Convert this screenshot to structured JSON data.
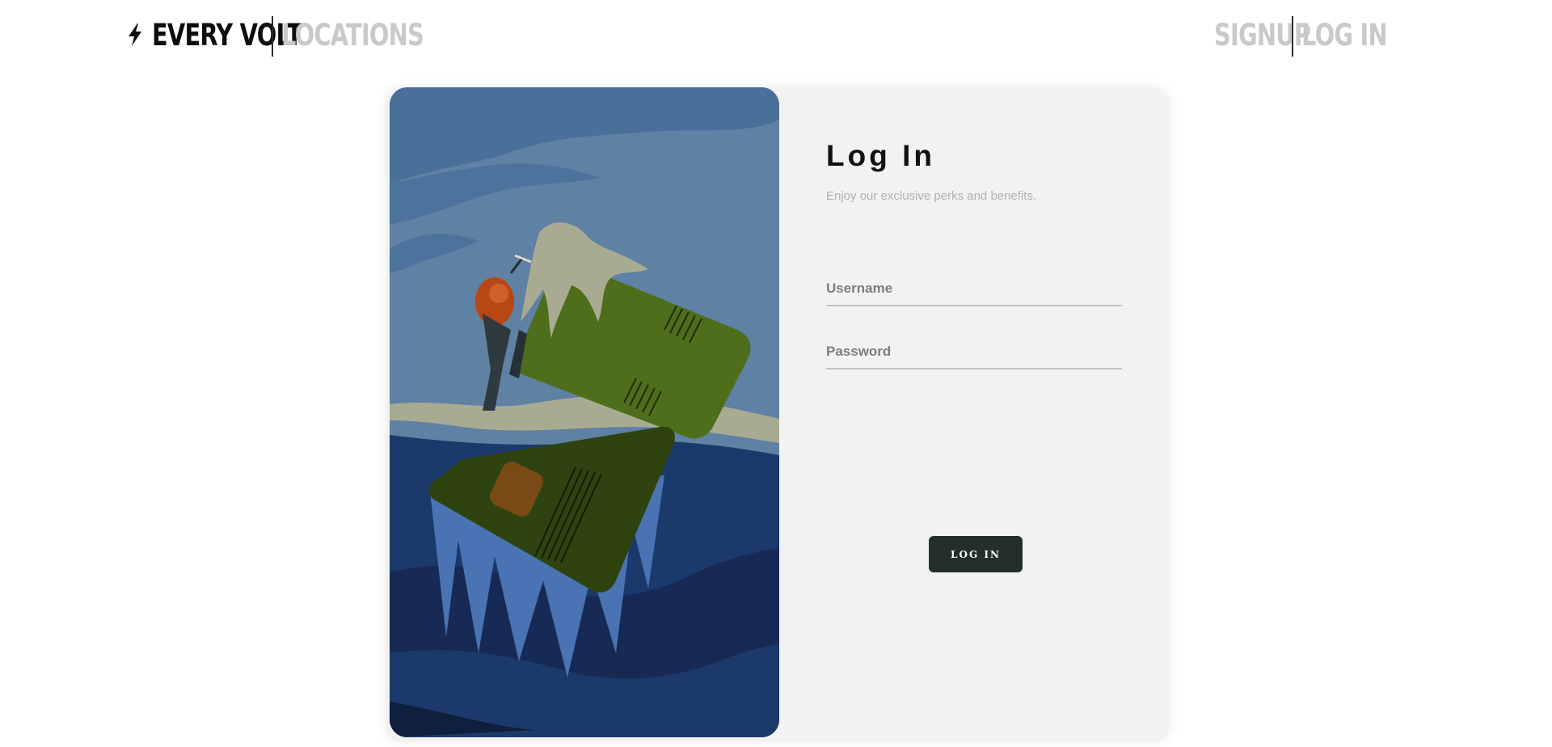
{
  "header": {
    "brand": "EVERY VOLT",
    "locations_link": "LOCATIONS",
    "signup_link": "SIGNUP",
    "login_link": "LOG IN"
  },
  "login": {
    "title": "Log In",
    "subtitle": "Enjoy our exclusive perks and benefits.",
    "username_placeholder": "Username",
    "password_placeholder": "Password",
    "button_label": "LOG IN"
  },
  "colors": {
    "button_bg": "#23302a",
    "card_bg": "#f2f2f2",
    "nav_inactive": "#c9c9c9",
    "brand": "#0d0d0d"
  },
  "icons": {
    "brand_icon": "lightning-bolt-icon"
  }
}
